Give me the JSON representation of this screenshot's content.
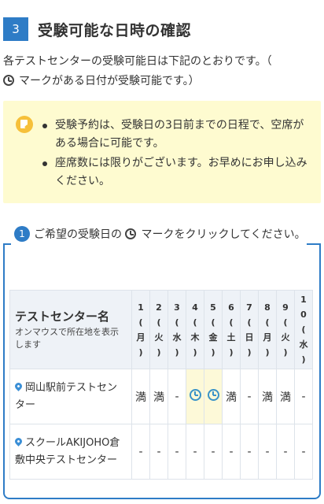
{
  "section": {
    "number": "3",
    "title": "受験可能な日時の確認"
  },
  "intro": {
    "line1": "各テストセンターの受験可能日は下記のとおりです。（",
    "line2": "マークがある日付が受験可能です。）"
  },
  "notice": {
    "icon": "memo-icon",
    "items": [
      "受験予約は、受験日の3日前までの日程で、空席がある場合に可能です。",
      "座席数には限りがございます。お早めにお申し込みください。"
    ]
  },
  "calendar": {
    "step_number": "1",
    "label_before": "ご希望の受験日の",
    "label_after": "マークをクリックしてください。",
    "header": {
      "center_title": "テストセンター名",
      "center_sub": "オンマウスで所在地を表示します"
    },
    "dates": [
      {
        "day": "1",
        "weekday": "月",
        "type": "weekday"
      },
      {
        "day": "2",
        "weekday": "火",
        "type": "weekday"
      },
      {
        "day": "3",
        "weekday": "水",
        "type": "weekday"
      },
      {
        "day": "4",
        "weekday": "木",
        "type": "weekday"
      },
      {
        "day": "5",
        "weekday": "金",
        "type": "weekday"
      },
      {
        "day": "6",
        "weekday": "土",
        "type": "sat"
      },
      {
        "day": "7",
        "weekday": "日",
        "type": "sun"
      },
      {
        "day": "8",
        "weekday": "月",
        "type": "weekday"
      },
      {
        "day": "9",
        "weekday": "火",
        "type": "weekday"
      },
      {
        "day": "10",
        "weekday": "水",
        "type": "weekday"
      }
    ],
    "rows": [
      {
        "name": "岡山駅前テストセンター",
        "cells": [
          "満",
          "満",
          "-",
          "available",
          "available",
          "満",
          "-",
          "満",
          "満",
          "-"
        ]
      },
      {
        "name": "スクールAKIJOHO倉敷中央テストセンター",
        "cells": [
          "-",
          "-",
          "-",
          "-",
          "-",
          "-",
          "-",
          "-",
          "-",
          "-"
        ]
      }
    ],
    "colors": {
      "accent": "#2e7cc6",
      "sat_header": "#e4f1fb",
      "sun_header": "#fbe6df",
      "available_cell": "#fdf9d8"
    }
  }
}
